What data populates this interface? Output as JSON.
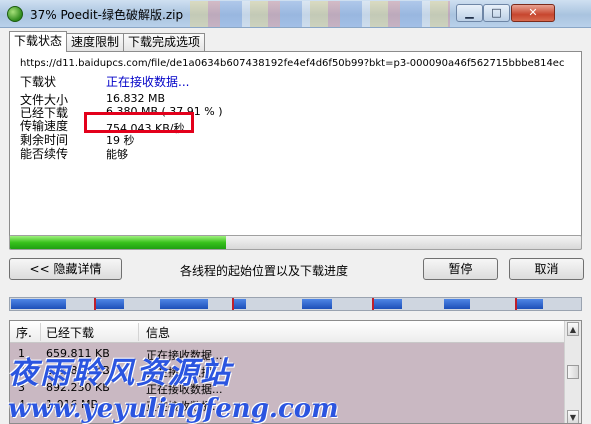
{
  "window": {
    "title": "37% Poedit-绿色破解版.zip",
    "controls": {
      "minimize": "▁",
      "maximize": "□",
      "close": "✕"
    }
  },
  "tabs": [
    {
      "label": "下载状态",
      "active": true
    },
    {
      "label": "速度限制",
      "active": false
    },
    {
      "label": "下载完成选项",
      "active": false
    }
  ],
  "status": {
    "url": "https://d11.baidupcs.com/file/de1a0634b607438192fe4ef4d6f50b99?bkt=p3-000090a46f562715bbbe814ec",
    "rows": [
      {
        "label": "下载状",
        "value": "正在接收数据..."
      },
      {
        "label": "文件大小",
        "value": "16.832  MB"
      },
      {
        "label": "已经下载",
        "value": "6.380  MB  ( 37.91 % )"
      },
      {
        "label": "传输速度",
        "value": "754.043  KB/秒"
      },
      {
        "label": "剩余时间",
        "value": "19 秒"
      },
      {
        "label": "能否续传",
        "value": "能够"
      }
    ]
  },
  "progress_percent": 37.91,
  "buttons": {
    "hide_details": "<< 隐藏详情",
    "pause": "暂停",
    "cancel": "取消"
  },
  "segments_label": "各线程的起始位置以及下载进度",
  "thread_list": {
    "columns": [
      "序.",
      "已经下载",
      "信息"
    ],
    "rows": [
      {
        "index": "1",
        "downloaded": "659.811  KB",
        "info": "正在接收数据..."
      },
      {
        "index": "2",
        "downloaded": "821.898  KB",
        "info": "正在接收数据..."
      },
      {
        "index": "3",
        "downloaded": "892.230  KB",
        "info": "正在接收数据..."
      },
      {
        "index": "4",
        "downloaded": "1.016  MB",
        "info": "正在接收数据..."
      }
    ]
  },
  "watermark": {
    "line1": "夜雨聆风资源站",
    "line2": "www.yeyulingfeng.com"
  },
  "colors": {
    "highlight_box": "#e3001b",
    "progress_fill": "#38c21c",
    "segment_blue": "#2a5fd0",
    "status_text": "#0000c8",
    "watermark": "#2b55e0"
  }
}
